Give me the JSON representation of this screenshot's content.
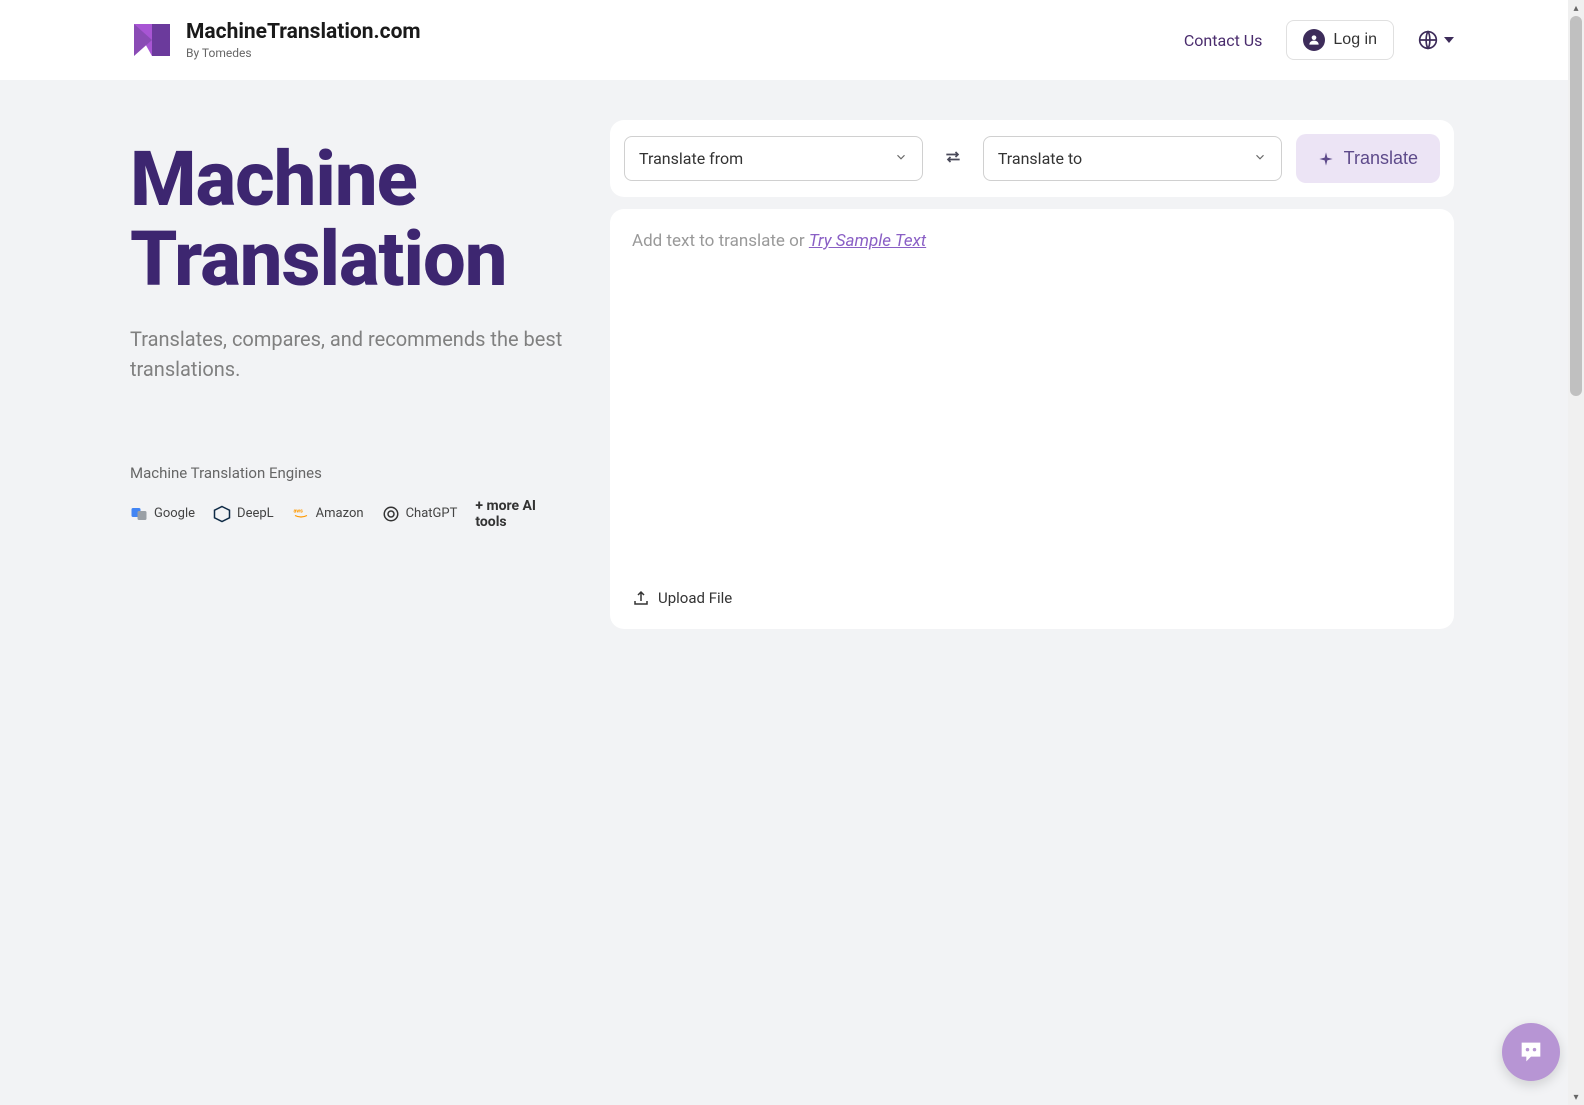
{
  "header": {
    "logo_title": "MachineTranslation.com",
    "logo_subtitle": "By Tomedes",
    "contact_label": "Contact Us",
    "login_label": "Log in"
  },
  "hero": {
    "title_line1": "Machine",
    "title_line2": "Translation",
    "subtitle": "Translates, compares, and recommends the best translations."
  },
  "engines": {
    "label": "Machine Translation Engines",
    "items": [
      {
        "name": "Google"
      },
      {
        "name": "DeepL"
      },
      {
        "name": "Amazon"
      },
      {
        "name": "ChatGPT"
      }
    ],
    "more_label": "+ more AI tools"
  },
  "translate_bar": {
    "from_label": "Translate from",
    "to_label": "Translate to",
    "translate_button": "Translate"
  },
  "text_area": {
    "placeholder_prefix": "Add text to translate or ",
    "sample_link": "Try Sample Text",
    "upload_label": "Upload File"
  }
}
